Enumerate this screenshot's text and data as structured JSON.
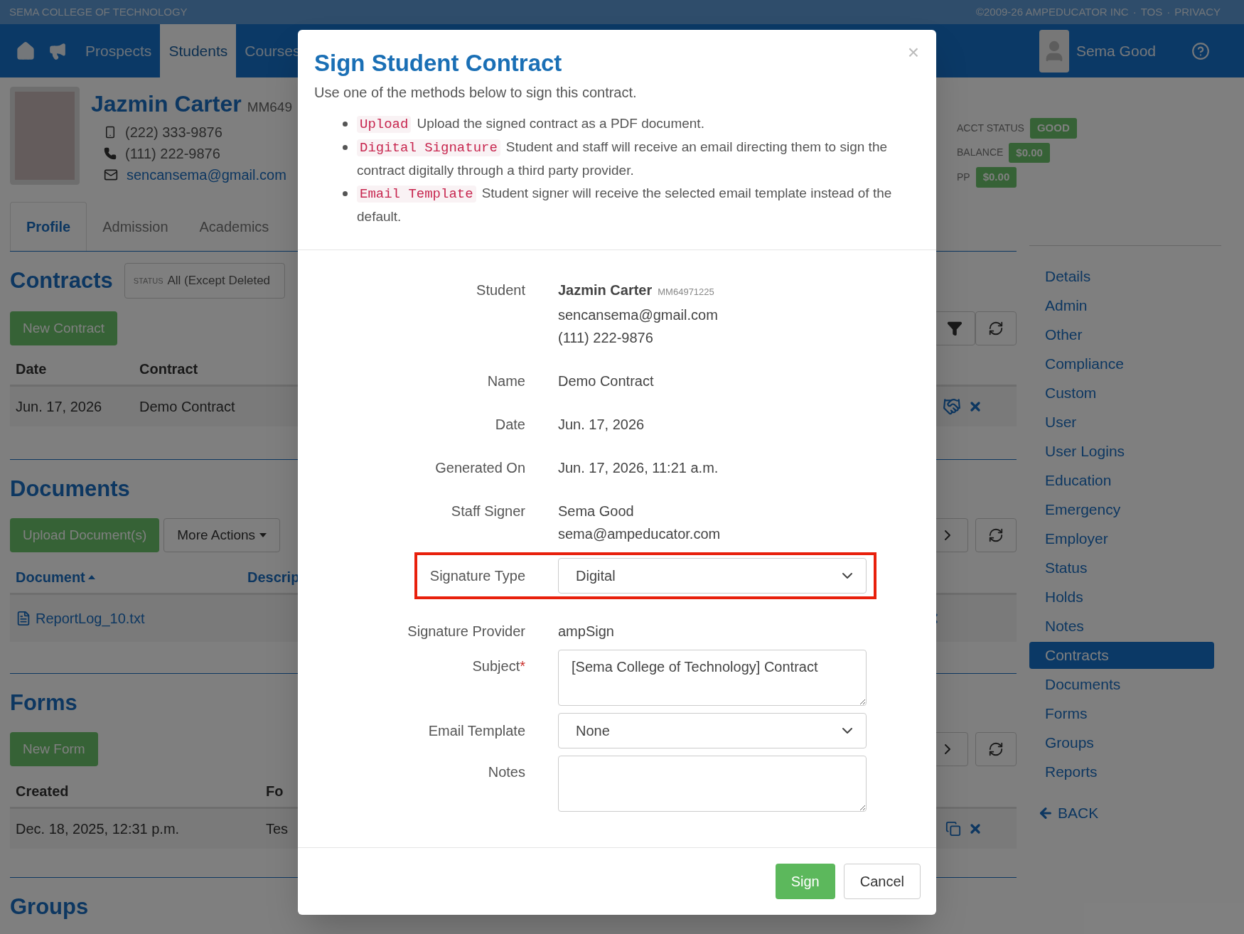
{
  "top_bar": {
    "school": "SEMA COLLEGE OF TECHNOLOGY",
    "links": [
      "©2009-26 AMPEDUCATOR INC",
      "TOS",
      "PRIVACY"
    ],
    "separator": "·"
  },
  "nav": {
    "items": [
      {
        "label": "Prospects",
        "selected": false
      },
      {
        "label": "Students",
        "selected": true
      },
      {
        "label": "Courses",
        "selected": false
      }
    ],
    "user": "Sema Good"
  },
  "student": {
    "name": "Jazmin Carter",
    "id": "MM649",
    "mobile": "(222) 333-9876",
    "phone": "(111) 222-9876",
    "email": "sencansema@gmail.com"
  },
  "account": [
    {
      "label": "ACCT STATUS",
      "value": "GOOD"
    },
    {
      "label": "BALANCE",
      "value": "$0.00"
    },
    {
      "label": "PP",
      "value": "$0.00"
    }
  ],
  "tabs": [
    {
      "label": "Profile",
      "selected": true
    },
    {
      "label": "Admission",
      "selected": false
    },
    {
      "label": "Academics",
      "selected": false
    }
  ],
  "contracts": {
    "title": "Contracts",
    "status_label": "STATUS",
    "status_value": "All (Except Deleted",
    "button": "New Contract",
    "columns": [
      "Date",
      "Contract"
    ],
    "rows": [
      [
        "Jun. 17, 2026",
        "Demo Contract"
      ]
    ]
  },
  "documents": {
    "title": "Documents",
    "buttons": [
      "Upload Document(s)",
      "More Actions"
    ],
    "columns": [
      "Document",
      "Descrip"
    ],
    "rows": [
      [
        "ReportLog_10.txt"
      ]
    ]
  },
  "forms": {
    "title": "Forms",
    "button": "New Form",
    "columns": [
      "Created",
      "Fo"
    ],
    "rows": [
      [
        "Dec. 18, 2025, 12:31 p.m.",
        "Tes"
      ]
    ]
  },
  "groups": {
    "title": "Groups"
  },
  "side_menu": [
    {
      "label": "Details",
      "selected": false
    },
    {
      "label": "Admin",
      "selected": false
    },
    {
      "label": "Other",
      "selected": false
    },
    {
      "label": "Compliance",
      "selected": false
    },
    {
      "label": "Custom",
      "selected": false
    },
    {
      "label": "User",
      "selected": false
    },
    {
      "label": "User Logins",
      "selected": false
    },
    {
      "label": "Education",
      "selected": false
    },
    {
      "label": "Emergency",
      "selected": false
    },
    {
      "label": "Employer",
      "selected": false
    },
    {
      "label": "Status",
      "selected": false
    },
    {
      "label": "Holds",
      "selected": false
    },
    {
      "label": "Notes",
      "selected": false
    },
    {
      "label": "Contracts",
      "selected": true
    },
    {
      "label": "Documents",
      "selected": false
    },
    {
      "label": "Forms",
      "selected": false
    },
    {
      "label": "Groups",
      "selected": false
    },
    {
      "label": "Reports",
      "selected": false
    }
  ],
  "back": "BACK",
  "dialog": {
    "title": "Sign Student Contract",
    "close": "×",
    "intro": "Use one of the methods below to sign this contract.",
    "methods": [
      {
        "code": "Upload",
        "text": "Upload the signed contract as a PDF document."
      },
      {
        "code": "Digital Signature",
        "text": "Student and staff will receive an email directing them to sign the contract digitally through a third party provider."
      },
      {
        "code": "Email Template",
        "text": "Student signer will receive the selected email template instead of the default."
      }
    ],
    "required_mark": "*",
    "fields": [
      {
        "kind": "student",
        "label": "Student",
        "name": "Jazmin Carter",
        "id": "MM64971225",
        "lines": [
          "sencansema@gmail.com",
          "(111) 222-9876"
        ]
      },
      {
        "kind": "text",
        "label": "Name",
        "lines": [
          "Demo Contract"
        ]
      },
      {
        "kind": "text",
        "label": "Date",
        "lines": [
          "Jun. 17, 2026"
        ]
      },
      {
        "kind": "text",
        "label": "Generated On",
        "lines": [
          "Jun. 17, 2026, 11:21 a.m."
        ]
      },
      {
        "kind": "text",
        "label": "Staff Signer",
        "lines": [
          "Sema Good",
          "sema@ampeducator.com"
        ]
      },
      {
        "kind": "select",
        "label": "Signature Type",
        "value": "Digital",
        "highlighted": true
      },
      {
        "kind": "text",
        "label": "Signature Provider",
        "lines": [
          "ampSign"
        ]
      },
      {
        "kind": "textarea",
        "label": "Subject",
        "required": true,
        "value": "[Sema College of Technology] Contract"
      },
      {
        "kind": "select",
        "label": "Email Template",
        "value": "None",
        "highlighted": false
      },
      {
        "kind": "textarea",
        "label": "Notes",
        "required": false
      }
    ],
    "buttons": [
      {
        "label": "Sign",
        "kind": "primary"
      },
      {
        "label": "Cancel",
        "kind": "default"
      }
    ]
  }
}
